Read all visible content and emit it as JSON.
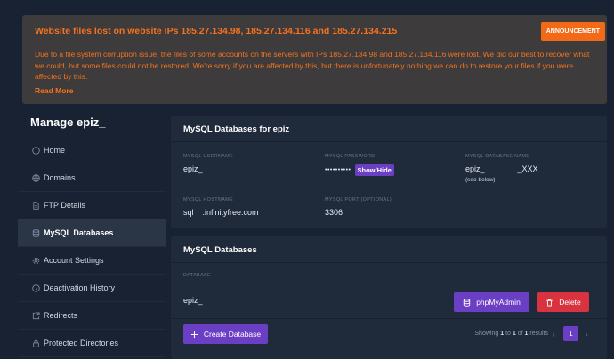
{
  "announcement": {
    "title": "Website files lost on website IPs 185.27.134.98, 185.27.134.116 and 185.27.134.215",
    "badge": "ANNOUNCEMENT",
    "body": "Due to a file system corruption issue, the files of some accounts on the servers with IPs 185.27.134.98 and 185.27.134.116 were lost. We did our best to recover what we could, but some files could not be restored. We're sorry if you are affected by this, but there is unfortunately nothing we can do to restore your files if you were affected by this.",
    "read_more": "Read More",
    "color": "#f47320"
  },
  "sidebar": {
    "title": "Manage epiz_",
    "items": [
      {
        "label": "Home",
        "icon": "info-icon"
      },
      {
        "label": "Domains",
        "icon": "globe-icon"
      },
      {
        "label": "FTP Details",
        "icon": "file-icon"
      },
      {
        "label": "MySQL Databases",
        "icon": "database-icon",
        "active": true
      },
      {
        "label": "Account Settings",
        "icon": "gear-icon"
      },
      {
        "label": "Deactivation History",
        "icon": "clock-icon"
      },
      {
        "label": "Redirects",
        "icon": "external-link-icon"
      },
      {
        "label": "Protected Directories",
        "icon": "lock-icon"
      }
    ]
  },
  "mysql_details": {
    "heading": "MySQL Databases for epiz_",
    "username_label": "MYSQL USERNAME",
    "username": "epiz_",
    "password_label": "MYSQL PASSWORD",
    "password_mask": "••••••••••",
    "show_hide": "Show/Hide",
    "dbname_label": "MYSQL DATABASE NAME",
    "dbname_prefix": "epiz_",
    "dbname_suffix": "_XXX",
    "dbname_note": "(see below)",
    "hostname_label": "MYSQL HOSTNAME",
    "hostname_prefix": "sql",
    "hostname_suffix": ".infinityfree.com",
    "port_label": "MYSQL PORT (OPTIONAL)",
    "port": "3306"
  },
  "databases": {
    "heading": "MySQL Databases",
    "column_header": "DATABASE",
    "rows": [
      {
        "name": "epiz_"
      }
    ],
    "phpmyadmin_label": "phpMyAdmin",
    "delete_label": "Delete",
    "create_label": "Create Database",
    "pagination": {
      "showing": "Showing",
      "from": "1",
      "to_word": "to",
      "to": "1",
      "of_word": "of",
      "total": "1",
      "results": "results",
      "prev": "‹",
      "current": "1",
      "next": "›"
    }
  },
  "colors": {
    "accent": "#6a3fc4",
    "danger": "#d9333f",
    "background": "#192233",
    "panel": "#1f2a3b"
  }
}
